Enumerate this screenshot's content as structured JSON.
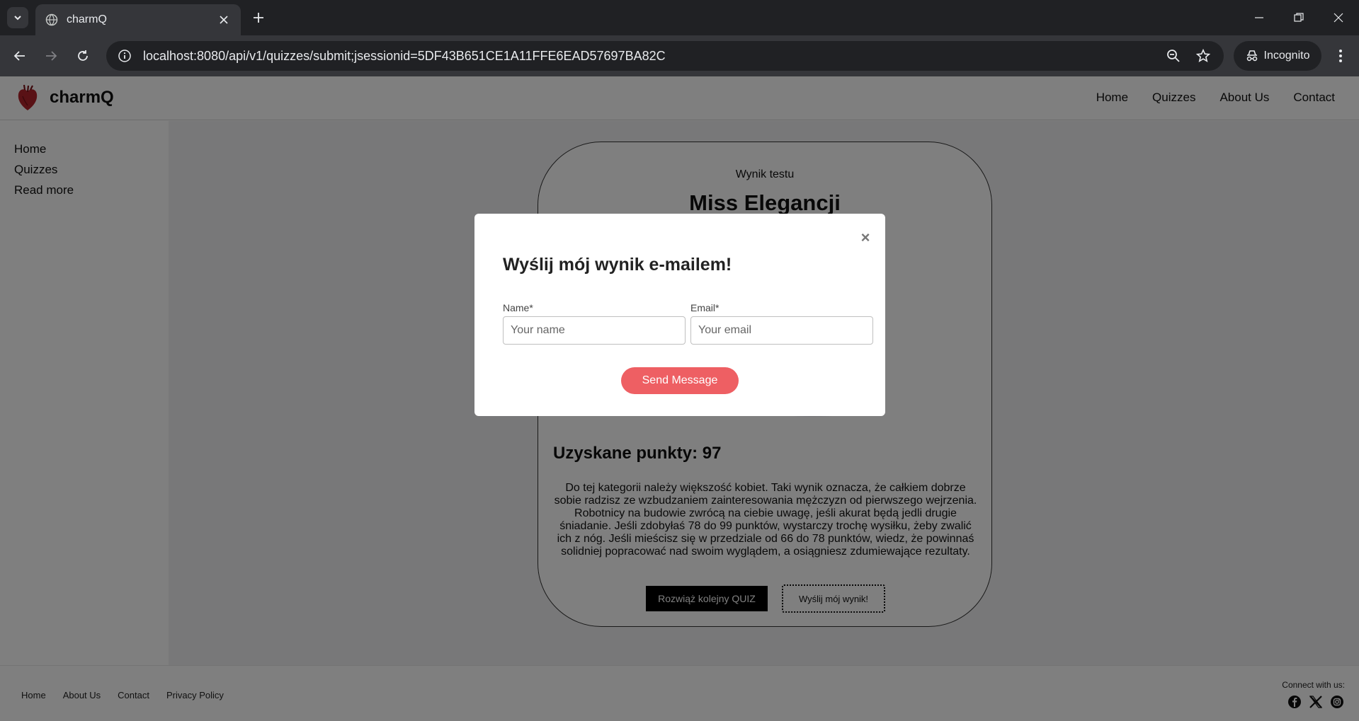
{
  "browser": {
    "tab_title": "charmQ",
    "url": "localhost:8080/api/v1/quizzes/submit;jsessionid=5DF43B651CE1A11FFE6EAD57697BA82C",
    "incognito_label": "Incognito"
  },
  "header": {
    "brand": "charmQ",
    "nav": [
      "Home",
      "Quizzes",
      "About Us",
      "Contact"
    ]
  },
  "sidebar": {
    "items": [
      "Home",
      "Quizzes",
      "Read more"
    ]
  },
  "result": {
    "subtitle": "Wynik testu",
    "title": "Miss Elegancji",
    "points_label": "Uzyskane punkty: 97",
    "description": "Do tej kategorii należy większość kobiet. Taki wynik oznacza, że całkiem dobrze sobie radzisz ze wzbudzaniem zainteresowania mężczyzn od pierwszego wejrzenia. Robotnicy na budowie zwrócą na ciebie uwagę, jeśli akurat będą jedli drugie śniadanie. Jeśli zdobyłaś 78 do 99 punktów, wystarczy trochę wysiłku, żeby zwalić ich z nóg. Jeśli mieścisz się w przedziale od 66 do 78 punktów, wiedz, że powinnaś solidniej popracować nad swoim wyglądem, a osiągniesz zdumiewające rezultaty.",
    "btn_next_quiz": "Rozwiąż kolejny QUIZ",
    "btn_send_result": "Wyślij mój wynik!"
  },
  "modal": {
    "close": "×",
    "title": "Wyślij mój wynik e-mailem!",
    "name_label": "Name*",
    "name_placeholder": "Your name",
    "email_label": "Email*",
    "email_placeholder": "Your email",
    "submit_label": "Send Message"
  },
  "footer": {
    "links": [
      "Home",
      "About Us",
      "Contact",
      "Privacy Policy"
    ],
    "connect_label": "Connect with us:",
    "social_icons": [
      "facebook-icon",
      "x-icon",
      "instagram-icon"
    ]
  },
  "colors": {
    "accent": "#ee5f63",
    "chrome_dark": "#202124",
    "chrome_mid": "#35363a"
  }
}
